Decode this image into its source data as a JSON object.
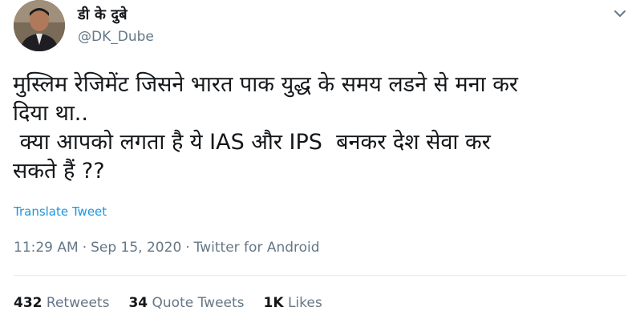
{
  "author": {
    "display_name": "डी के दुबे",
    "handle": "@DK_Dube"
  },
  "tweet": {
    "text": "मुस्लिम रेजिमेंट जिसने भारत पाक युद्ध के समय लडने से मना कर\nदिया था..\n क्या आपको लगता है ये IAS और IPS  बनकर देश सेवा कर\nसकते हैं ??",
    "translate_label": "Translate Tweet",
    "time": "11:29 AM",
    "date": "Sep 15, 2020",
    "source": "Twitter for Android",
    "separator": "·"
  },
  "stats": {
    "retweets_count": "432",
    "retweets_label": "Retweets",
    "quote_count": "34",
    "quote_label": "Quote Tweets",
    "likes_count": "1K",
    "likes_label": "Likes"
  },
  "icons": {
    "menu": "chevron-down-icon"
  },
  "colors": {
    "link": "#1b95e0",
    "secondary_text": "#657786",
    "divider": "#e6ecf0"
  }
}
